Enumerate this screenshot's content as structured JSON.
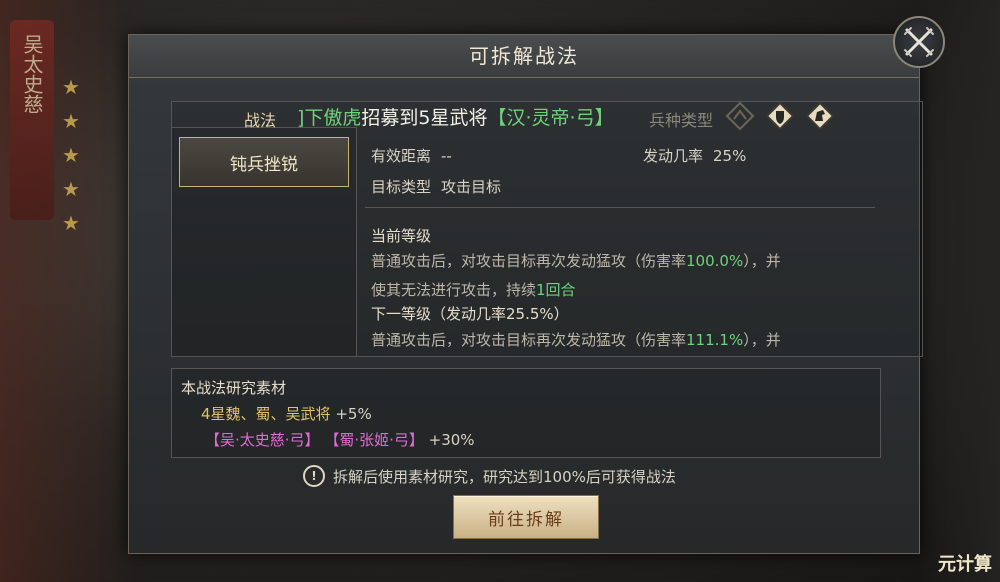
{
  "background": {
    "banner_text": "吴太史慈",
    "watermark": "元计算"
  },
  "dialog": {
    "title": "可拆解战法",
    "close_icon": "crossed-swords-close-icon"
  },
  "skill": {
    "label": "战法",
    "marquee_prefix": "]下傲虎",
    "marquee_main": "招募到5星武将",
    "marquee_hero": "【汉·灵帝·弓】",
    "troop_label": "兵种类型",
    "troop_icons": [
      "cavalry-icon",
      "shield-icon",
      "horse-icon"
    ],
    "selected_name": "钝兵挫锐",
    "range_label": "有效距离",
    "range_value": "--",
    "rate_label": "发动几率",
    "rate_value": "25%",
    "target_label": "目标类型",
    "target_value": "攻击目标",
    "current_level_title": "当前等级",
    "current_desc_1a": "普通攻击后，对攻击目标再次发动猛攻（伤害率",
    "current_desc_1b": "100.0%",
    "current_desc_1c": "），并",
    "current_desc_2a": "使其无法进行攻击，持续",
    "current_desc_2b": "1回合",
    "next_level_title": "下一等级（发动几率25.5%）",
    "next_desc_1a": "普通攻击后，对攻击目标再次发动猛攻（伤害率",
    "next_desc_1b": "111.1%",
    "next_desc_1c": "），并"
  },
  "materials": {
    "title": "本战法研究素材",
    "line1_text": "4星魏、蜀、吴武将",
    "line1_bonus": "+5%",
    "line2_hero1": "【吴·太史慈·弓】",
    "line2_hero2": "【蜀·张姬·弓】",
    "line2_bonus": "+30%"
  },
  "notice": {
    "icon": "warning-circle-icon",
    "text": "拆解后使用素材研究，研究达到100%后可获得战法"
  },
  "action": {
    "button_label": "前往拆解"
  },
  "colors": {
    "highlight_green": "#6fd27a",
    "hero_pink": "#e06bd4",
    "gold": "#e2c36a"
  }
}
